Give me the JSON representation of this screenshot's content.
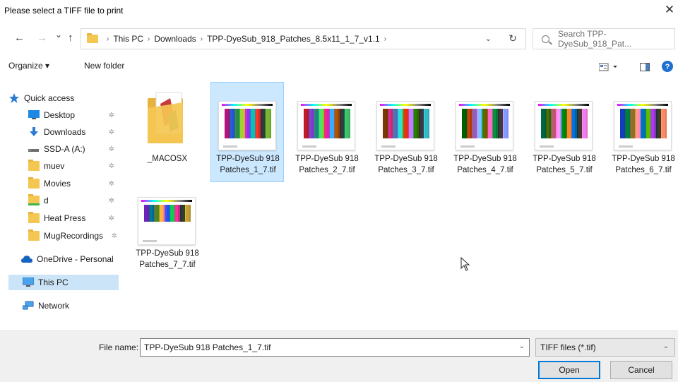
{
  "window": {
    "title": "Please select a TIFF file to print",
    "close_glyph": "✕"
  },
  "nav": {
    "back": "←",
    "forward": "→",
    "recent": "⌄",
    "up": "↑"
  },
  "address": {
    "path": [
      "This PC",
      "Downloads",
      "TPP-DyeSub_918_Patches_8.5x11_1_7_v1.1"
    ],
    "separator": "›",
    "dropdown": "⌄",
    "refresh": "↻"
  },
  "search": {
    "placeholder": "Search TPP-DyeSub_918_Pat..."
  },
  "toolbar": {
    "organize": "Organize ▾",
    "new_folder": "New folder",
    "help": "?"
  },
  "sidebar": {
    "items": [
      {
        "label": "Quick access",
        "icon": "star-icon"
      },
      {
        "label": "Desktop",
        "icon": "desktop-icon",
        "pinned": true
      },
      {
        "label": "Downloads",
        "icon": "download-arrow-icon",
        "pinned": true
      },
      {
        "label": "SSD-A (A:)",
        "icon": "drive-icon",
        "pinned": true
      },
      {
        "label": "muev",
        "icon": "folder-icon",
        "pinned": true
      },
      {
        "label": "Movies",
        "icon": "folder-icon",
        "pinned": true
      },
      {
        "label": "d",
        "icon": "folder-icon",
        "pinned": true
      },
      {
        "label": "Heat Press",
        "icon": "folder-icon",
        "pinned": true
      },
      {
        "label": "MugRecordings",
        "icon": "folder-icon",
        "pinned": true
      },
      {
        "label": "OneDrive - Personal",
        "icon": "cloud-icon"
      },
      {
        "label": "This PC",
        "icon": "computer-icon",
        "selected": true
      },
      {
        "label": "Network",
        "icon": "network-icon"
      }
    ],
    "pin_glyph": "✲"
  },
  "files": [
    {
      "name": "_MACOSX",
      "type": "folder"
    },
    {
      "name": "TPP-DyeSub 918 Patches_1_7.tif",
      "line1": "TPP-DyeSub 918",
      "line2": "Patches_1_7.tif",
      "selected": true
    },
    {
      "name": "TPP-DyeSub 918 Patches_2_7.tif",
      "line1": "TPP-DyeSub 918",
      "line2": "Patches_2_7.tif"
    },
    {
      "name": "TPP-DyeSub 918 Patches_3_7.tif",
      "line1": "TPP-DyeSub 918",
      "line2": "Patches_3_7.tif"
    },
    {
      "name": "TPP-DyeSub 918 Patches_4_7.tif",
      "line1": "TPP-DyeSub 918",
      "line2": "Patches_4_7.tif"
    },
    {
      "name": "TPP-DyeSub 918 Patches_5_7.tif",
      "line1": "TPP-DyeSub 918",
      "line2": "Patches_5_7.tif"
    },
    {
      "name": "TPP-DyeSub 918 Patches_6_7.tif",
      "line1": "TPP-DyeSub 918",
      "line2": "Patches_6_7.tif"
    },
    {
      "name": "TPP-DyeSub 918 Patches_7_7.tif",
      "line1": "TPP-DyeSub 918",
      "line2": "Patches_7_7.tif"
    }
  ],
  "bottom": {
    "file_name_label": "File name:",
    "file_name_value": "TPP-DyeSub 918 Patches_1_7.tif",
    "filter": "TIFF files (*.tif)",
    "dropdown": "⌄",
    "open": "Open",
    "cancel": "Cancel"
  },
  "colors": {
    "selection": "#cce8ff",
    "selection_border": "#99d1ff",
    "accent": "#0078d7",
    "folder": "#f4c752"
  }
}
